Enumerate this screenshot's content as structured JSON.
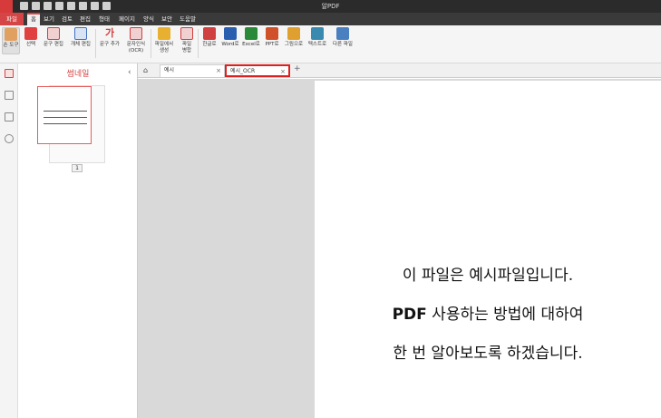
{
  "window": {
    "title": "알PDF"
  },
  "menu": [
    "파일",
    "홈",
    "보기",
    "검토",
    "편집",
    "형태",
    "페이지",
    "양식",
    "보안",
    "도움말"
  ],
  "ribbon": [
    {
      "label": "손 도구",
      "icon": "hand-icon",
      "color": "#e0a060"
    },
    {
      "label": "선택",
      "icon": "select-icon",
      "color": "#e04040"
    },
    {
      "label": "문구 편집",
      "icon": "edit-text-icon",
      "color": "#d04040"
    },
    {
      "label": "개체 편집",
      "icon": "edit-object-icon",
      "color": "#4070c0"
    },
    {
      "label": "문구 추가",
      "icon": "add-text-icon",
      "color": "#d04040"
    },
    {
      "label": "문자인식\n(OCR)",
      "icon": "ocr-icon",
      "color": "#d04040"
    },
    {
      "label": "파일에서\n생성",
      "icon": "folder-icon",
      "color": "#e8b030"
    },
    {
      "label": "파일\n병합",
      "icon": "merge-icon",
      "color": "#d04040"
    },
    {
      "label": "한글로",
      "icon": "hwp-icon",
      "color": "#d04040"
    },
    {
      "label": "Word로",
      "icon": "word-icon",
      "color": "#2a5fb0"
    },
    {
      "label": "Excel로",
      "icon": "excel-icon",
      "color": "#2a8a3a"
    },
    {
      "label": "PPT로",
      "icon": "ppt-icon",
      "color": "#d0502a"
    },
    {
      "label": "그림으로",
      "icon": "image-icon",
      "color": "#e0a030"
    },
    {
      "label": "텍스트로",
      "icon": "text-icon",
      "color": "#3a8ab0"
    },
    {
      "label": "다른 파일",
      "icon": "other-file-icon",
      "color": "#4a80c0"
    }
  ],
  "thumbnail_panel": {
    "title": "썸네일",
    "page_number": "1"
  },
  "tabs": [
    {
      "label": "예시",
      "close": "×"
    },
    {
      "label": "예시_OCR",
      "close": "×"
    }
  ],
  "add_tab": "+",
  "document": {
    "line1": "이 파일은 예시파일입니다.",
    "line2_bold": "PDF",
    "line2_rest": " 사용하는 방법에 대하여",
    "line3": "한 번 알아보도록 하겠습니다."
  }
}
